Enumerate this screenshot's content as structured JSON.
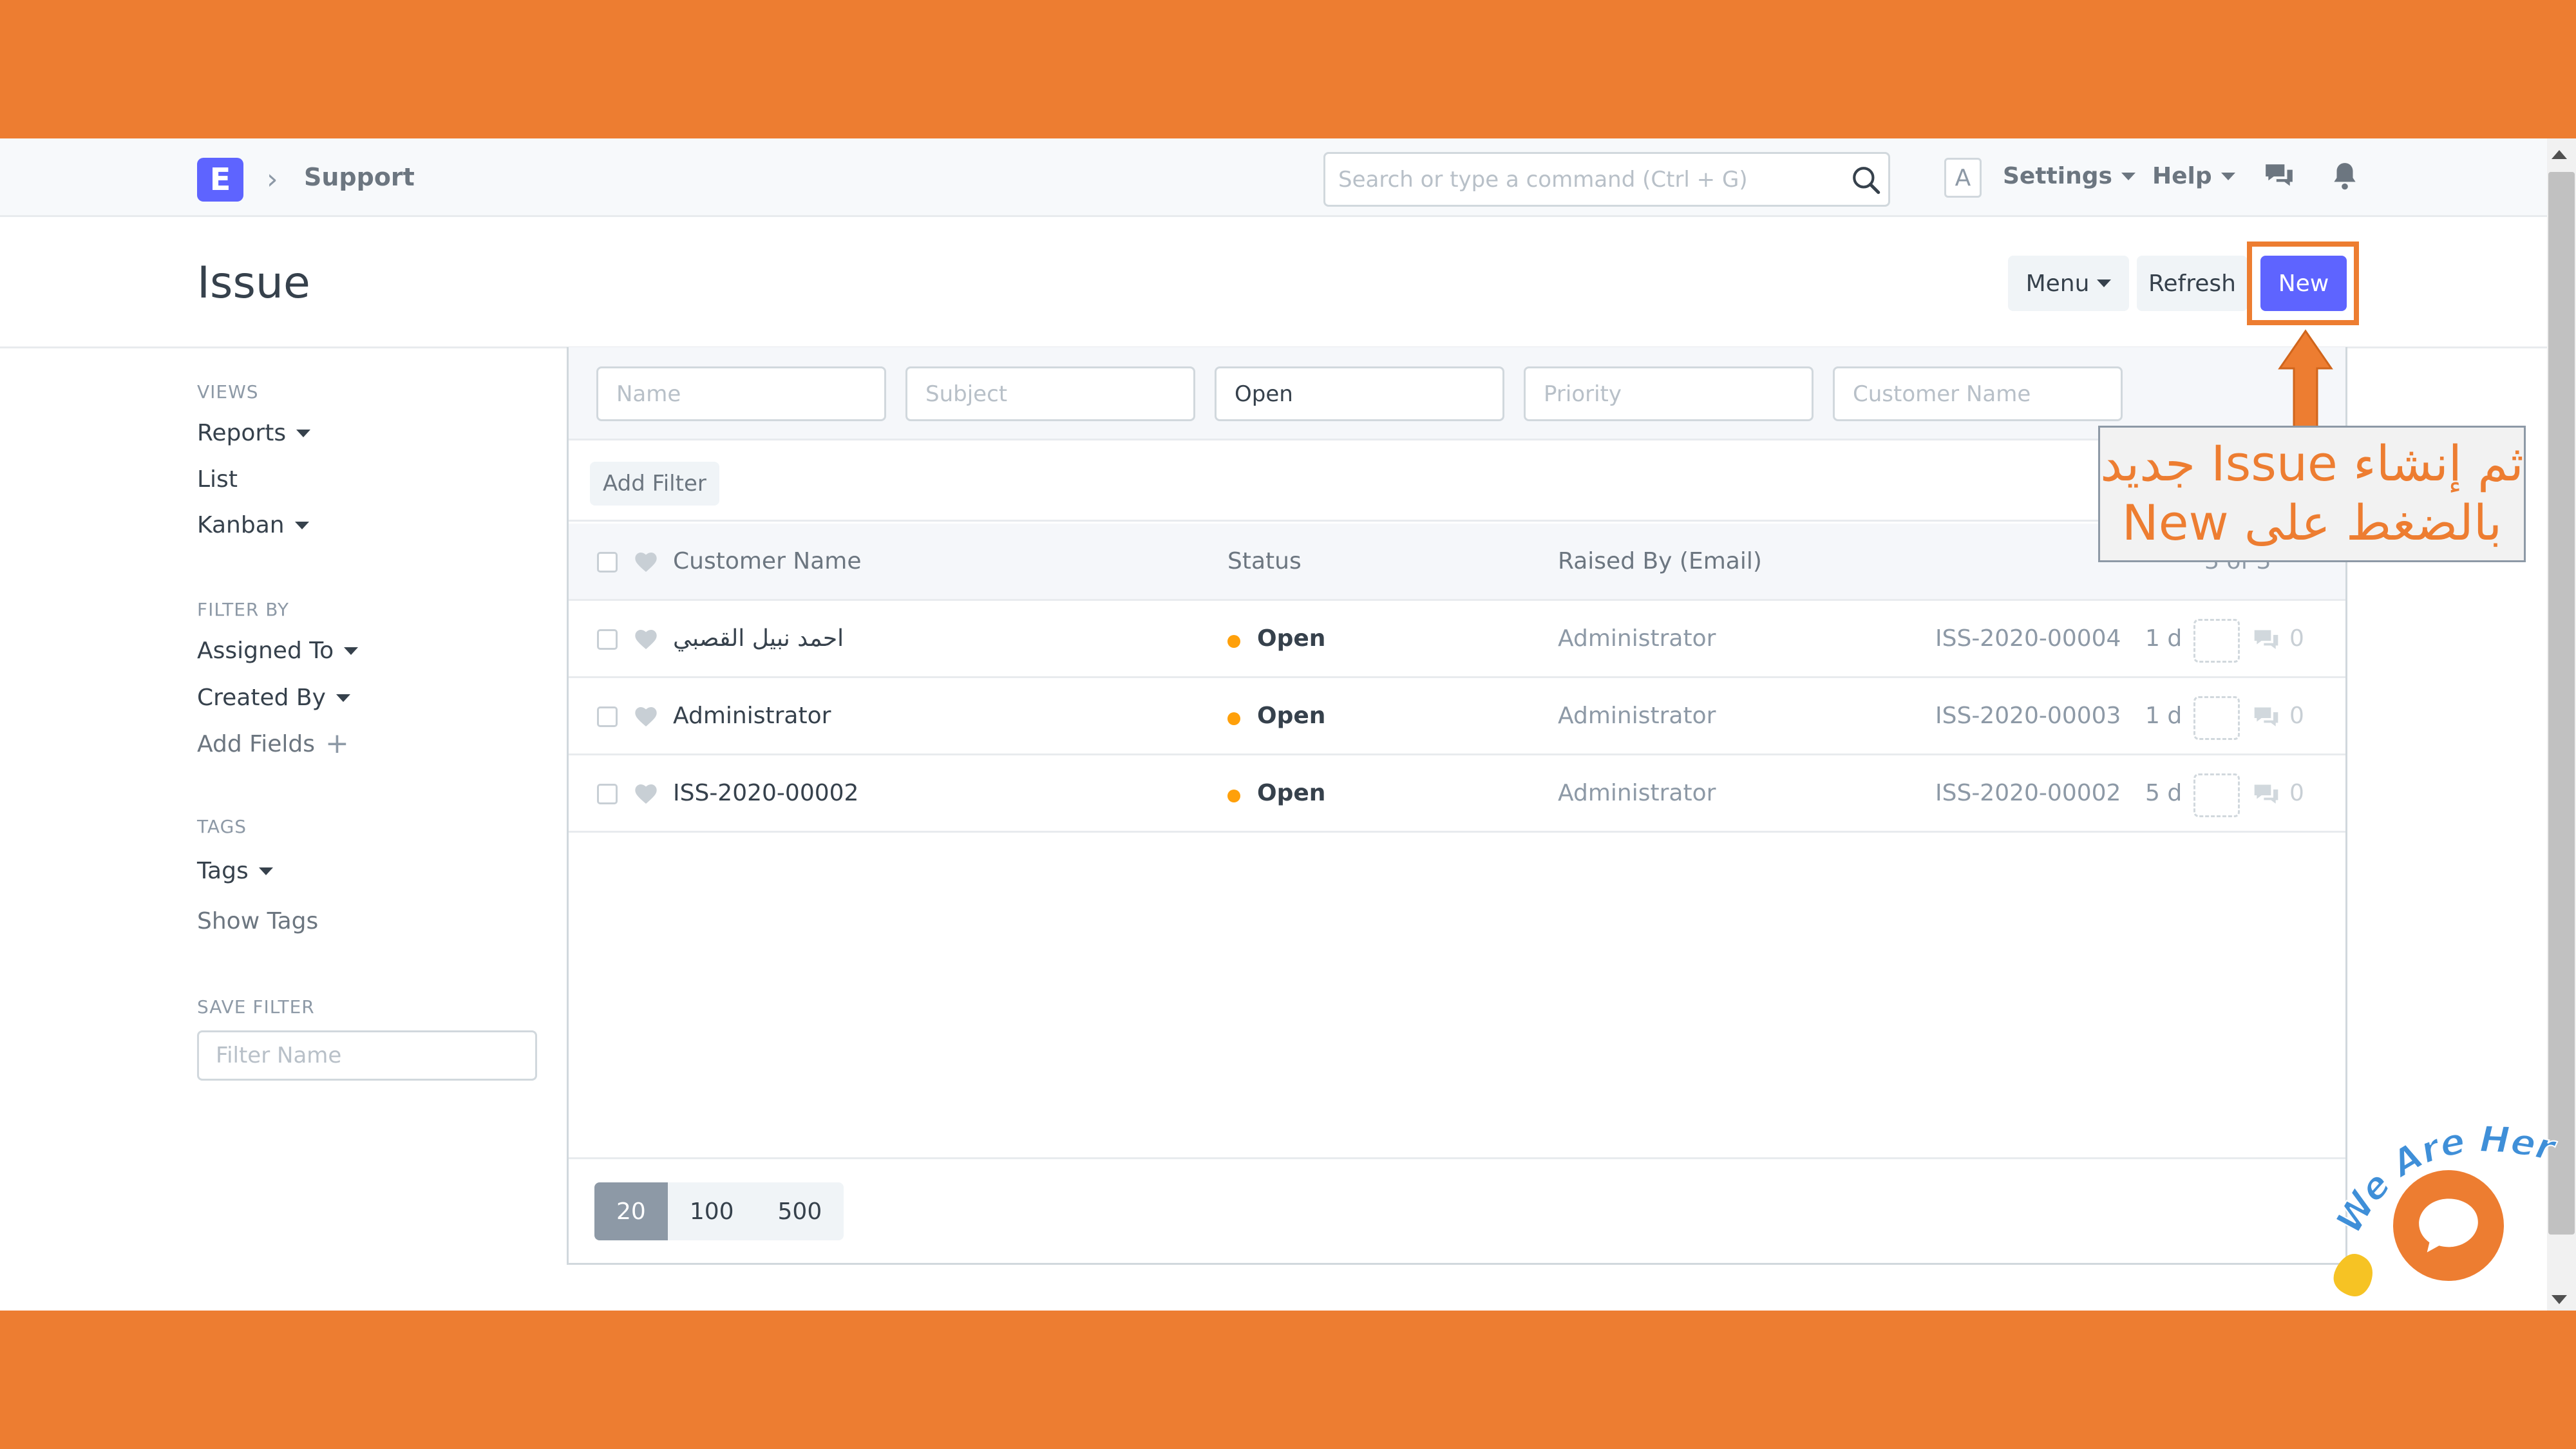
{
  "navbar": {
    "logo_letter": "E",
    "breadcrumb": "Support",
    "search_placeholder": "Search or type a command (Ctrl + G)",
    "avatar_letter": "A",
    "settings": "Settings",
    "help": "Help"
  },
  "page": {
    "title": "Issue",
    "menu_label": "Menu",
    "refresh_label": "Refresh",
    "new_label": "New"
  },
  "sidebar": {
    "views_heading": "VIEWS",
    "views": [
      "Reports",
      "List",
      "Kanban"
    ],
    "filter_by_heading": "FILTER BY",
    "assigned_to": "Assigned To",
    "created_by": "Created By",
    "add_fields": "Add Fields",
    "tags_heading": "TAGS",
    "tags": "Tags",
    "show_tags": "Show Tags",
    "save_filter_heading": "SAVE FILTER",
    "filter_name_placeholder": "Filter Name"
  },
  "filters": {
    "name_placeholder": "Name",
    "subject_placeholder": "Subject",
    "status_value": "Open",
    "priority_placeholder": "Priority",
    "customer_placeholder": "Customer Name",
    "add_filter": "Add Filter"
  },
  "table": {
    "columns": [
      "Customer Name",
      "Status",
      "Raised By (Email)"
    ],
    "count": "3 of 3",
    "rows": [
      {
        "customer": "احمد نبيل القصبي",
        "status": "Open",
        "raised_by": "Administrator",
        "id": "ISS-2020-00004",
        "age": "1 d",
        "comments": "0"
      },
      {
        "customer": "Administrator",
        "status": "Open",
        "raised_by": "Administrator",
        "id": "ISS-2020-00003",
        "age": "1 d",
        "comments": "0"
      },
      {
        "customer": "ISS-2020-00002",
        "status": "Open",
        "raised_by": "Administrator",
        "id": "ISS-2020-00002",
        "age": "5 d",
        "comments": "0"
      }
    ]
  },
  "paging": [
    "20",
    "100",
    "500"
  ],
  "callout": {
    "line1": "ثم إنشاء Issue جديد",
    "line2": "بالضغط على New"
  },
  "chat": {
    "badge_text": "We Are Here!"
  },
  "colors": {
    "accent": "#ED7D31",
    "primary": "#5e64ff",
    "status_open": "#ffa00a"
  }
}
